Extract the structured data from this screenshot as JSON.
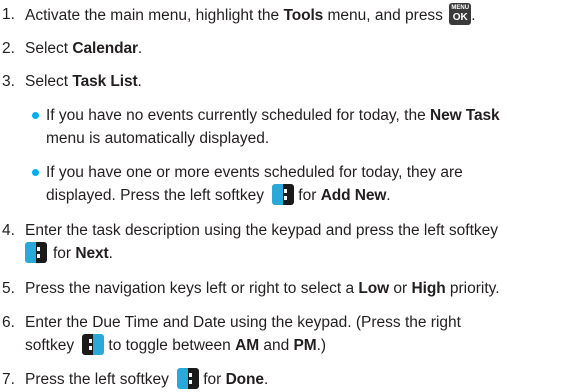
{
  "steps": [
    {
      "num": "1.",
      "a": "Activate the main menu, highlight the ",
      "b1": "Tools",
      "c": " menu, and press"
    },
    {
      "num": "2.",
      "a": "Select ",
      "b1": "Calendar",
      "c": "."
    },
    {
      "num": "3.",
      "a": "Select ",
      "b1": "Task List",
      "c": "."
    },
    {
      "num": "4.",
      "l1": "Enter the task description using the keypad and press the left softkey",
      "l2b": "for ",
      "b1": "Next",
      "c": "."
    },
    {
      "num": "5.",
      "a": "Press the navigation keys left or right to select a ",
      "b1": "Low",
      "mid": " or ",
      "b2": "High",
      "c": " priority."
    },
    {
      "num": "6.",
      "l1": "Enter the Due Time and Date using the keypad. (Press the right",
      "l2a": "softkey",
      "l2b": "to toggle between ",
      "b1": "AM",
      "mid": " and ",
      "b2": "PM",
      "c": ".)"
    },
    {
      "num": "7.",
      "a": "Press the left softkey",
      "b0": "for ",
      "b1": "Done",
      "c": "."
    }
  ],
  "bullets": [
    {
      "a": "If you have no events currently scheduled for today, the ",
      "b1": "New Task",
      "l2": "menu is automatically displayed."
    },
    {
      "a": "If you have one or more events scheduled for today, they are",
      "l2a": "displayed. Press the left softkey",
      "l2b": "for ",
      "b1": "Add New",
      "c": "."
    }
  ],
  "icons": {
    "menu_ok_top": "MENU",
    "menu_ok_bottom": "OK",
    "left_softkey": "left-softkey-icon",
    "right_softkey": "right-softkey-icon"
  },
  "colors": {
    "bullet": "#00aeef",
    "text": "#231f20"
  }
}
